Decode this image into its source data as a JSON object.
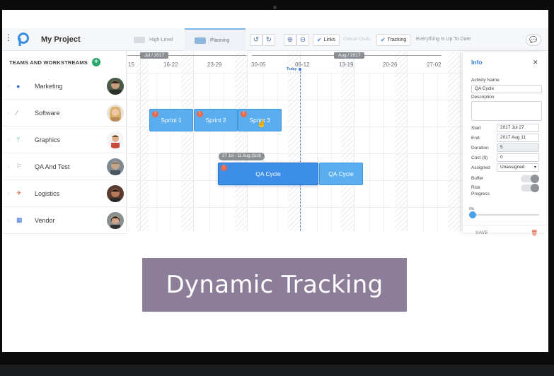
{
  "app": {
    "project_title": "My Project",
    "tabs": [
      {
        "label": "High-Level",
        "icon": "layers-icon"
      },
      {
        "label": "Planning",
        "icon": "layers-icon"
      }
    ],
    "toolbar": {
      "links_label": "Links",
      "critical_label": "Critical Chain",
      "tracking_label": "Tracking",
      "status": "Everything Is Up To Date"
    }
  },
  "teams": {
    "header": "TEAMS AND WORKSTREAMS",
    "rows": [
      {
        "name": "Marketing",
        "icon": "globe-icon",
        "icon_color": "#3b6fd8"
      },
      {
        "name": "Software",
        "icon": "magic-wand-icon",
        "icon_color": "#c65bd0"
      },
      {
        "name": "Graphics",
        "icon": "fork-icon",
        "icon_color": "#3aa67a"
      },
      {
        "name": "QA And Test",
        "icon": "flag-icon",
        "icon_color": "#8a8f98"
      },
      {
        "name": "Logistics",
        "icon": "plane-icon",
        "icon_color": "#e06b45"
      },
      {
        "name": "Vendor",
        "icon": "calendar-icon",
        "icon_color": "#3b6fd8"
      }
    ]
  },
  "timeline": {
    "months": [
      "Jul / 2017",
      "Aug / 2017"
    ],
    "weeks": [
      "15",
      "16-22",
      "23-29",
      "30-05",
      "06-12",
      "13-19",
      "20-26",
      "27-02"
    ],
    "today_label": "Today",
    "bars": [
      {
        "label": "Sprint 1",
        "badge": "!"
      },
      {
        "label": "Sprint 2",
        "badge": "!"
      },
      {
        "label": "Sprint 3",
        "badge": "!"
      },
      {
        "label": "QA Cycle",
        "badge": "!"
      },
      {
        "label": "QA Cycle",
        "badge": ""
      }
    ],
    "tooltip": "27 Jul - 11 Aug (11d)"
  },
  "info": {
    "title": "Info",
    "activity_name_label": "Activity Name",
    "activity_name": "QA Cycle",
    "description_label": "Description",
    "start_label": "Start",
    "start": "2017 Jul 27",
    "end_label": "End",
    "end": "2017 Aug 11",
    "duration_label": "Duration",
    "duration": "5",
    "cost_label": "Cost ($)",
    "cost": "0",
    "assigned_label": "Assigned",
    "assigned": "Unassigned",
    "buffer_label": "Buffer",
    "risk_label": "Risk",
    "progress_label": "Progress",
    "progress_pct": "0%",
    "progress_value": 0,
    "save_label": "SAVE"
  },
  "banner": {
    "text": "Dynamic Tracking",
    "color": "#8c7d98"
  },
  "colors": {
    "accent": "#2f7bd6",
    "bar": "#5aaef0",
    "badge": "#e46b4f"
  }
}
